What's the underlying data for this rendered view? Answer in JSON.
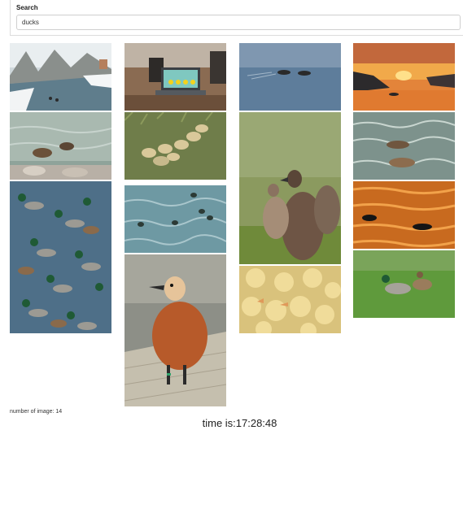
{
  "search": {
    "label": "Search",
    "value": "ducks"
  },
  "gallery": {
    "images": [
      {
        "subject": "snowy river with ducks"
      },
      {
        "subject": "laptop screen with rubber ducks"
      },
      {
        "subject": "ducks swimming on calm blue lake"
      },
      {
        "subject": "sunset over lake with boat"
      },
      {
        "subject": "two ducks on water near rocks"
      },
      {
        "subject": "ducklings in grass"
      },
      {
        "subject": "two ducks on sparkling water"
      },
      {
        "subject": "mallard ducks swimming"
      },
      {
        "subject": "ducks on pale teal water"
      },
      {
        "subject": "brown ducklings close-up"
      },
      {
        "subject": "silhouetted ducks on golden water"
      },
      {
        "subject": "ruddy shelduck on wooden boardwalk"
      },
      {
        "subject": "yellow ducklings group"
      },
      {
        "subject": "mallard pair on grass"
      }
    ]
  },
  "footer": {
    "count_text": "number of image: 14",
    "time_text": "time is:17:28:48"
  },
  "colors": {
    "panel_border": "#dcdcdc",
    "text": "#222222"
  }
}
